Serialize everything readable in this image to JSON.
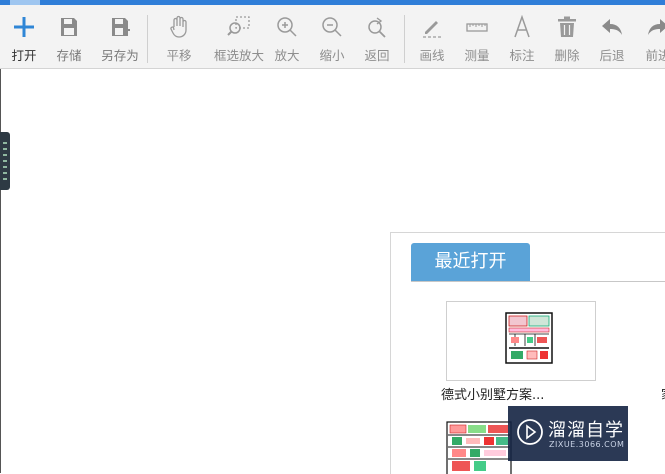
{
  "toolbar": {
    "open": "打开",
    "save": "存储",
    "save_as": "另存为",
    "pan": "平移",
    "zoom_window": "框选放大",
    "zoom_in": "放大",
    "zoom_out": "缩小",
    "back": "返回",
    "draw_line": "画线",
    "measure": "测量",
    "annotate": "标注",
    "delete": "删除",
    "undo": "后退",
    "redo": "前进"
  },
  "recent": {
    "tab_label": "最近打开",
    "items": [
      {
        "name": "德式小别墅方案..."
      },
      {
        "name": "家"
      }
    ]
  },
  "watermark": {
    "title": "溜溜自学",
    "subtitle": "ZIXUE.3066.COM"
  },
  "colors": {
    "accent": "#2f7ed8",
    "tab_bg": "#5aa3d8",
    "icon_blue": "#2f86d6"
  }
}
